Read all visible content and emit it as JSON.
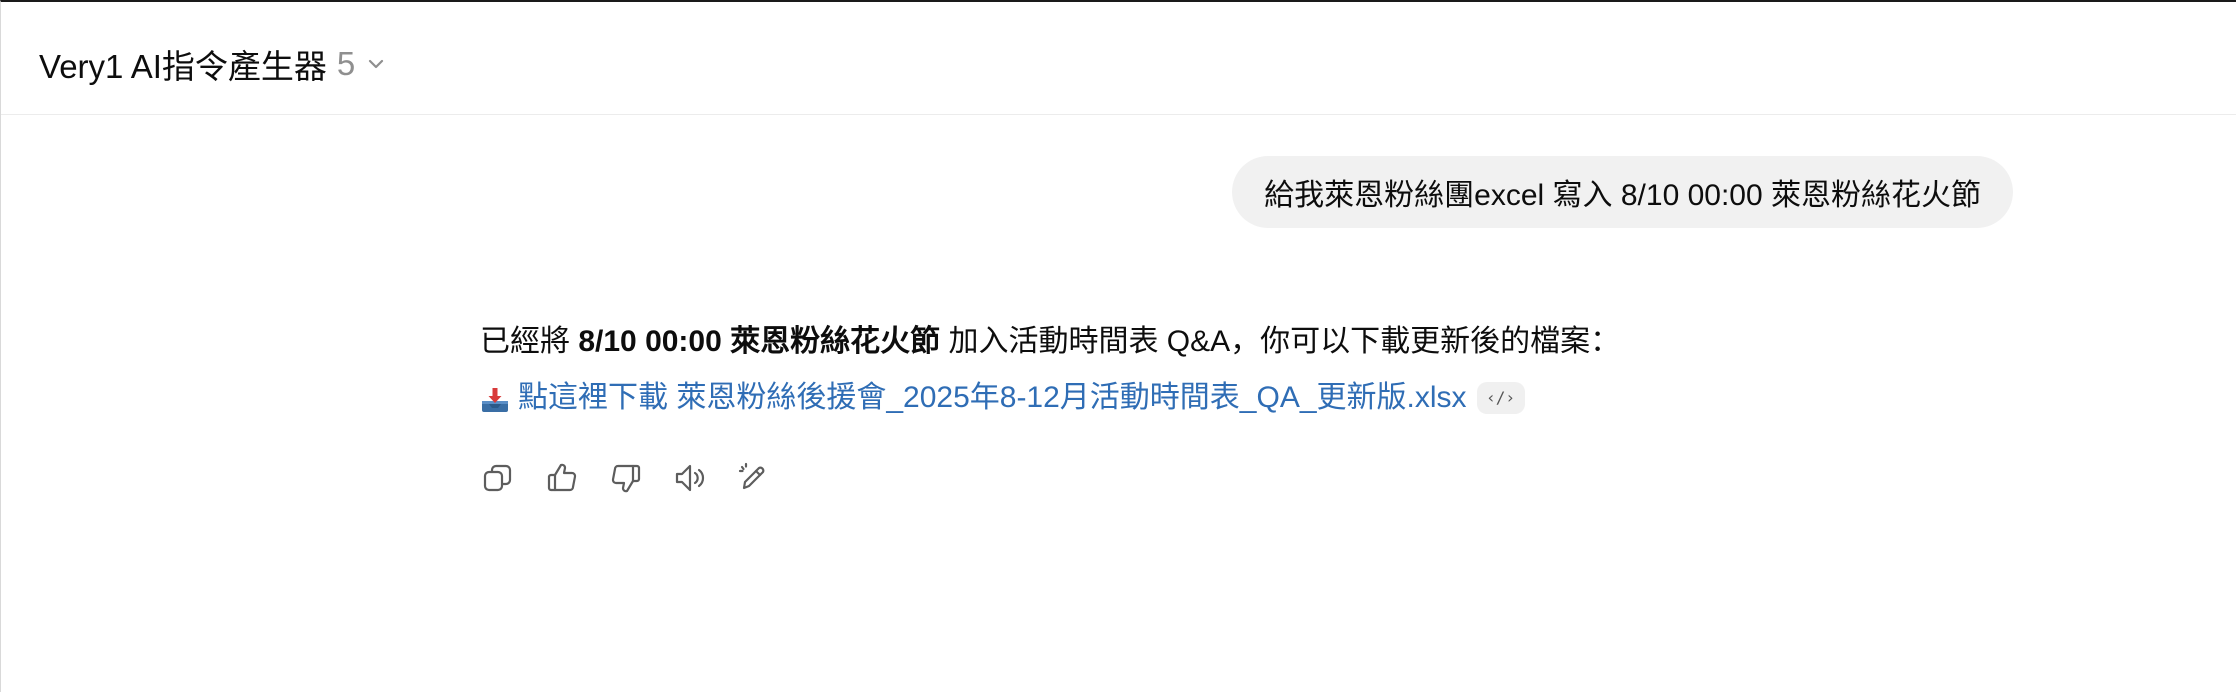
{
  "header": {
    "model_name": "Very1 AI指令產生器",
    "model_version": "5",
    "chevron_icon": "chevron-down-icon"
  },
  "user_message": {
    "text": "給我萊恩粉絲團excel 寫入 8/10  00:00 萊恩粉絲花火節"
  },
  "assistant_message": {
    "line1_prefix": "已經將 ",
    "line1_bold": "8/10 00:00 萊恩粉絲花火節",
    "line1_suffix": " 加入活動時間表 Q&A，你可以下載更新後的檔案：",
    "download_icon": "inbox-tray-emoji",
    "download_link": "點這裡下載 萊恩粉絲後援會_2025年8-12月活動時間表_QA_更新版.xlsx",
    "code_badge": "‹/›"
  },
  "actions": [
    {
      "name": "copy-icon"
    },
    {
      "name": "thumbs-up-icon"
    },
    {
      "name": "thumbs-down-icon"
    },
    {
      "name": "read-aloud-icon"
    },
    {
      "name": "edit-icon"
    }
  ]
}
